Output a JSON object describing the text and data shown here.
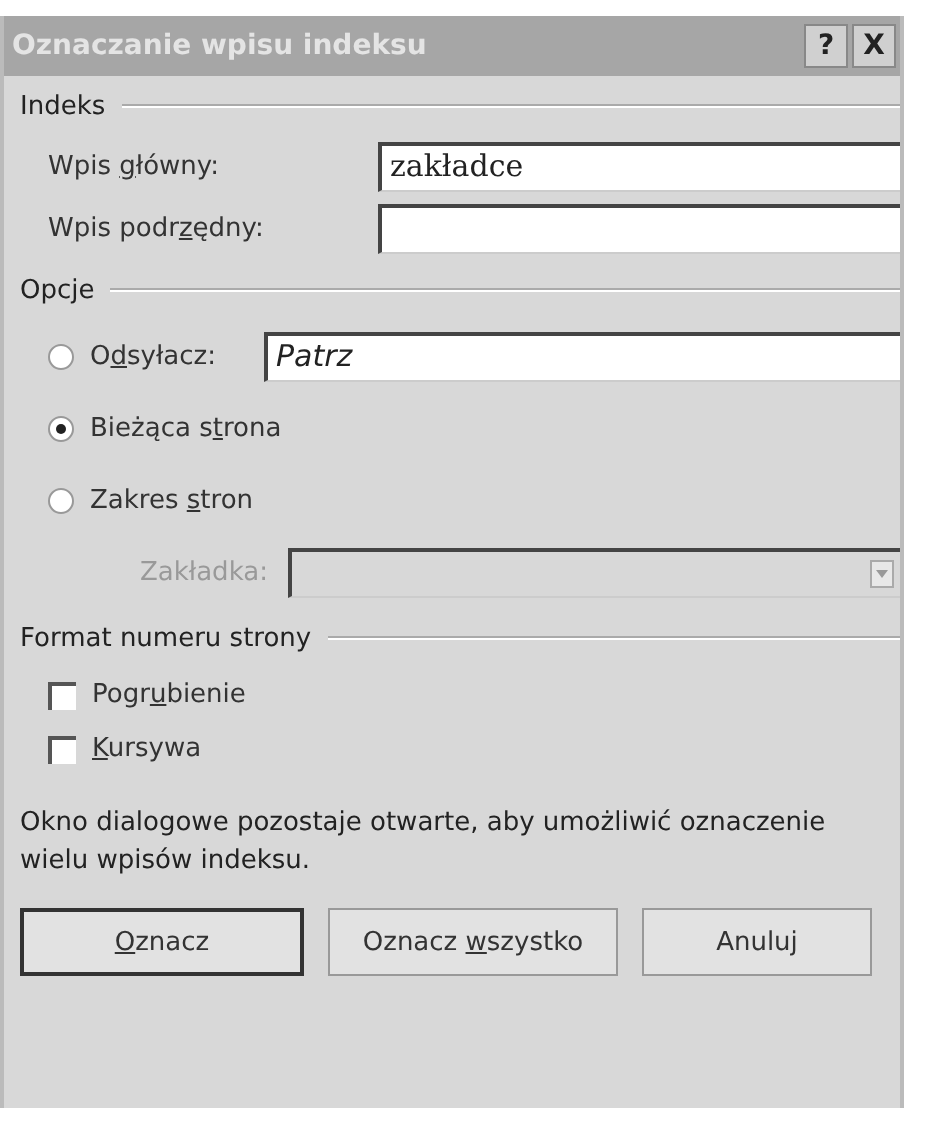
{
  "window": {
    "title": "Oznaczanie wpisu indeksu",
    "help": "?",
    "close": "X"
  },
  "index": {
    "title": "Indeks",
    "fields": [
      {
        "label": {
          "before": "Wpis ",
          "key": "g",
          "after": "łówny:"
        },
        "value": "zakładce"
      },
      {
        "label": {
          "before": "Wpis podr",
          "key": "z",
          "after": "ędny:"
        }
      }
    ]
  },
  "options": {
    "title": "Opcje",
    "items": [
      {
        "kind": "radio-field",
        "label": {
          "before": "O",
          "key": "d",
          "after": "syłacz:"
        },
        "selected": false,
        "value": "Patrz"
      },
      {
        "kind": "radio",
        "label": {
          "before": "Bieżąca s",
          "key": "t",
          "after": "rona"
        },
        "selected": true
      },
      {
        "kind": "radio",
        "label": {
          "before": "Zakres ",
          "key": "s",
          "after": "tron"
        },
        "selected": false
      },
      {
        "kind": "dropdown",
        "label": {
          "before": "Zakładka:"
        },
        "disabled": true
      }
    ]
  },
  "format": {
    "title": "Format numeru strony",
    "items": [
      {
        "label": {
          "before": "Pogr",
          "key": "u",
          "after": "bienie"
        },
        "checked": false
      },
      {
        "label": {
          "key": "K",
          "after": "ursywa"
        },
        "checked": false
      }
    ]
  },
  "note": "Okno dialogowe pozostaje otwarte, aby umożliwić oznaczenie wielu wpisów indeksu.",
  "buttons": [
    {
      "label": {
        "key": "O",
        "after": "znacz"
      },
      "default": true
    },
    {
      "label": {
        "before": "Oznacz ",
        "key": "w",
        "after": "szystko"
      },
      "default": false
    },
    {
      "label": {
        "before": "Anuluj"
      },
      "default": false
    }
  ]
}
